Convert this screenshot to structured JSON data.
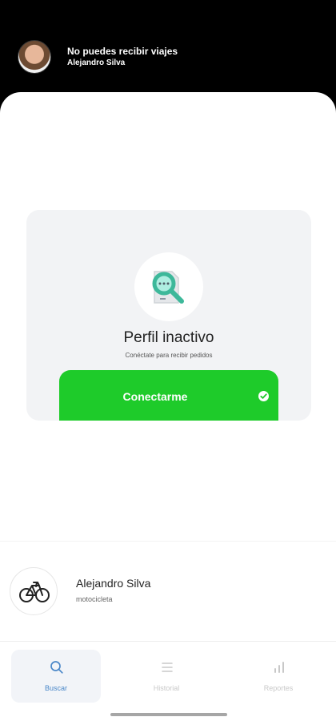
{
  "status": {
    "title": "No puedes recibir viajes",
    "name": "Alejandro Silva"
  },
  "profile_card": {
    "title": "Perfil inactivo",
    "subtitle": "Conéctate para recibir pedidos",
    "button_label": "Conectarme",
    "icon": "document-search-icon",
    "accent_color": "#1ecb2a"
  },
  "vehicle": {
    "driver_name": "Alejandro Silva",
    "vehicle_type": "motocicleta",
    "icon": "bicycle-icon"
  },
  "bottom_nav": {
    "items": [
      {
        "label": "Buscar",
        "icon": "search-icon",
        "active": true
      },
      {
        "label": "Historial",
        "icon": "list-icon",
        "active": false
      },
      {
        "label": "Reportes",
        "icon": "bar-chart-icon",
        "active": false
      }
    ]
  }
}
